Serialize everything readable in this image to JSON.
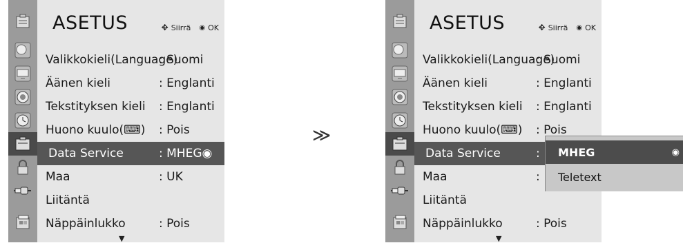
{
  "menu": {
    "title": "ASETUS",
    "hint_move": "Siirrä",
    "hint_ok": "OK",
    "move_icon_glyph": "✥",
    "ok_icon_glyph": "◉",
    "scroll_glyph": "▼",
    "rows": [
      {
        "label": "Valikkokieli(Language)",
        "value": ": Suomi"
      },
      {
        "label": "Äänen kieli",
        "value": ": Englanti"
      },
      {
        "label": "Tekstityksen kieli",
        "value": ": Englanti"
      },
      {
        "label": "Huono kuulo(⌨)",
        "value": ": Pois"
      },
      {
        "label": "Data Service",
        "value": ": MHEG◉"
      },
      {
        "label": "Maa",
        "value": ": UK"
      },
      {
        "label": "Liitäntä",
        "value": ""
      },
      {
        "label": "Näppäinlukko",
        "value": ": Pois"
      }
    ],
    "right_rows": [
      {
        "label": "Valikkokieli(Language)",
        "value": ": Suomi"
      },
      {
        "label": "Äänen kieli",
        "value": ": Englanti"
      },
      {
        "label": "Tekstityksen kieli",
        "value": ": Englanti"
      },
      {
        "label": "Huono kuulo(⌨)",
        "value": ": Pois"
      },
      {
        "label": "Data Service",
        "value": ":"
      },
      {
        "label": "Maa",
        "value": ":"
      },
      {
        "label": "Liitäntä",
        "value": ""
      },
      {
        "label": "Näppäinlukko",
        "value": ": Pois"
      }
    ],
    "selected_row": "Data Service"
  },
  "separator_glyph": "≫",
  "popup": {
    "options": [
      {
        "label": "MHEG",
        "selected": true,
        "radio_glyph": "◉"
      },
      {
        "label": "Teletext",
        "selected": false
      }
    ]
  },
  "icons": [
    "setup-header-icon",
    "picture-icon",
    "screen-icon",
    "audio-icon",
    "time-icon",
    "option-icon",
    "lock-icon",
    "input-icon",
    "media-icon"
  ],
  "colors": {
    "menu_bg": "#e6e6e6",
    "icon_column": "#9b9b9b",
    "selected_row": "#565656",
    "popup_bg": "#c8c8c8",
    "popup_active": "#4c4c4c"
  }
}
